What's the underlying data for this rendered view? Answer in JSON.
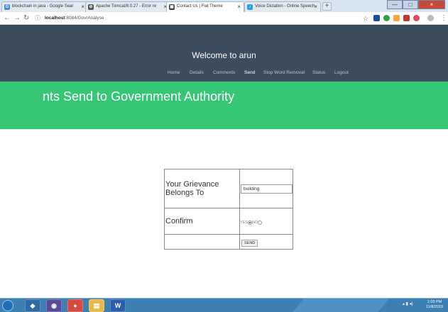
{
  "browser": {
    "tabs": [
      {
        "title": "blockchain in java - Google Sear",
        "icon": "google-icon",
        "color": "#4285f4"
      },
      {
        "title": "Apache Tomcat/8.0.27 - Error re",
        "icon": "tomcat-icon",
        "color": "#555555"
      },
      {
        "title": "Contact Us | Flat Theme",
        "icon": "page-icon",
        "color": "#333a45"
      },
      {
        "title": "Voice Dictation - Online Speech",
        "icon": "mic-icon",
        "color": "#2e9be5"
      }
    ],
    "tab_close_glyph": "×",
    "new_tab_glyph": "+",
    "url_host": "localhost",
    "url_path": ":8084/Gov/Analyse",
    "window_controls": {
      "minimize": "—",
      "maximize": "□",
      "close": "×"
    }
  },
  "site": {
    "title": "Welcome to arun",
    "nav": [
      "Home",
      "Details",
      "Comments",
      "Send",
      "Stop Word Removal",
      "Status",
      "Logout"
    ],
    "active_nav": "Send",
    "banner_title": "nts Send to Government Authority",
    "header_color": "#3a4c5e",
    "banner_color": "#35c775"
  },
  "form": {
    "grievance_label": "Your Grievance Belongs To",
    "grievance_value": "building",
    "confirm_label": "Confirm",
    "radio_yes": "YES",
    "radio_no": "NO",
    "selected": "YES",
    "send_label": "SEND"
  },
  "taskbar": {
    "apps": [
      "start-icon",
      "virtualbox-icon",
      "eclipse-icon",
      "chrome-icon",
      "explorer-icon",
      "word-icon"
    ],
    "clock_time": "1:03 PM",
    "clock_date": "11/8/2019"
  }
}
